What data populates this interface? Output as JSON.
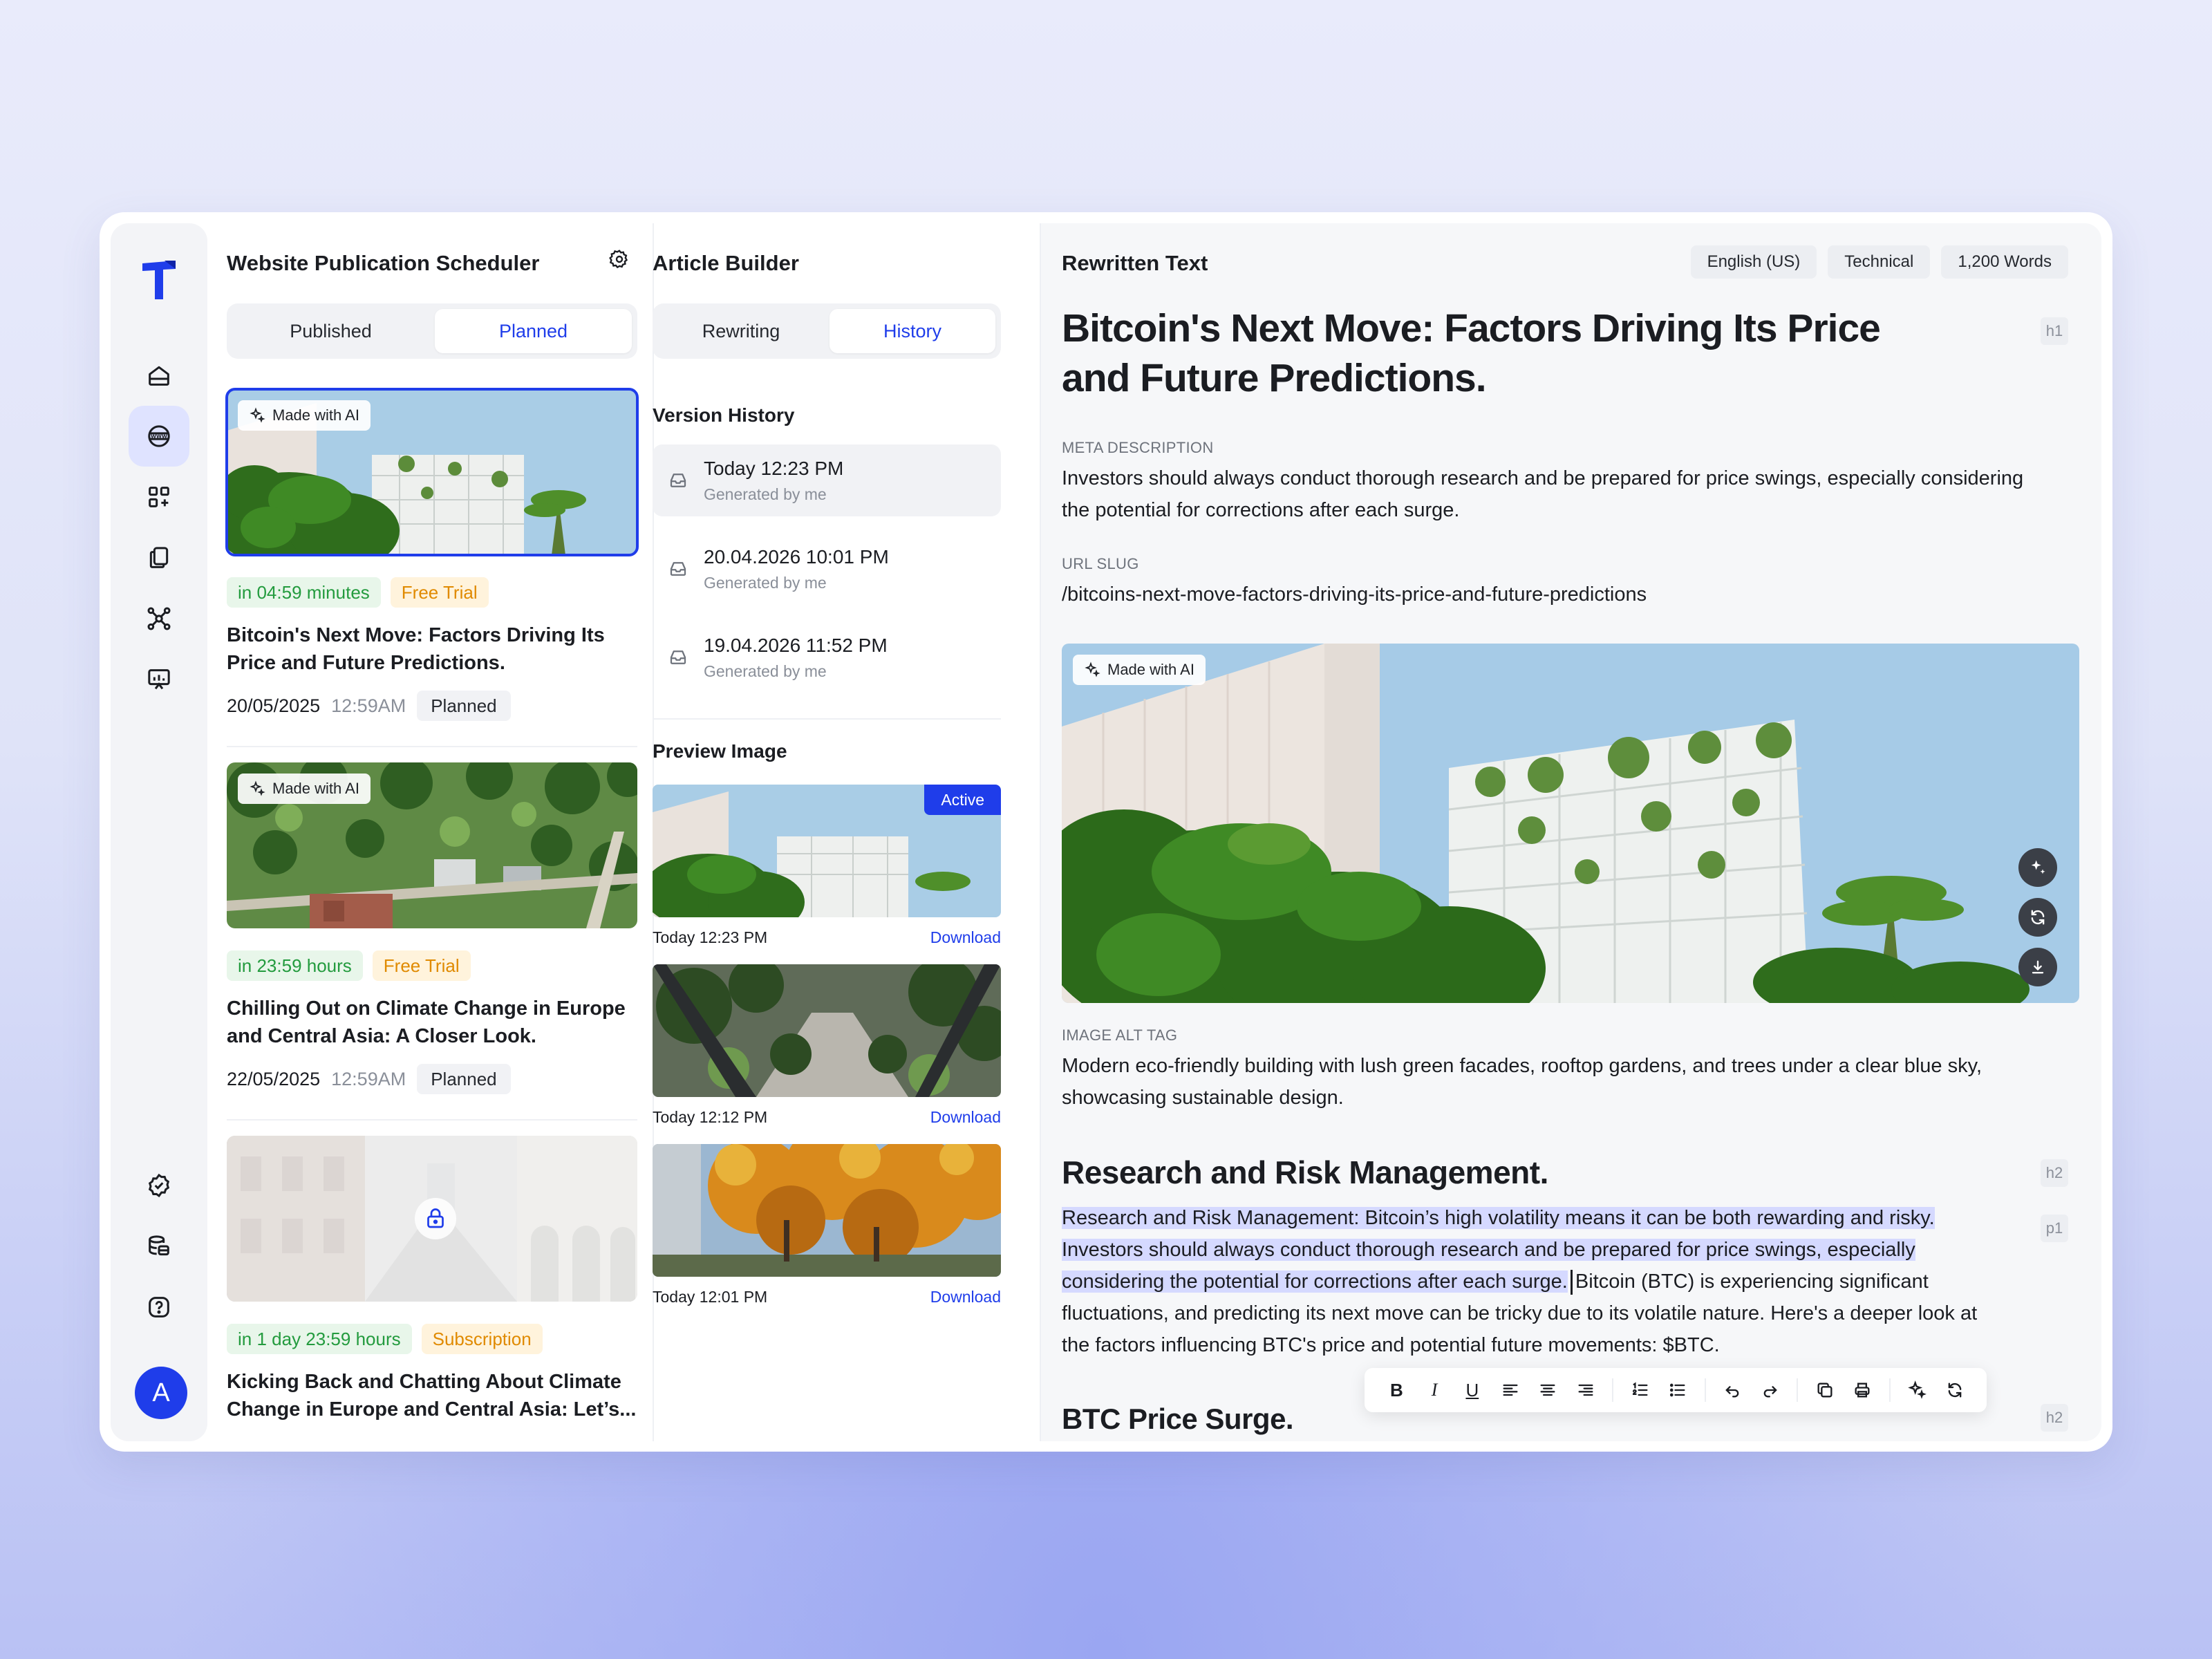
{
  "sidebar": {
    "avatar_initial": "A",
    "items": [
      "home-icon",
      "website-icon",
      "apps-icon",
      "documents-icon",
      "network-icon",
      "analytics-icon",
      "verified-icon",
      "database-icon",
      "help-icon"
    ]
  },
  "scheduler": {
    "title": "Website Publication Scheduler",
    "tabs": [
      "Published",
      "Planned"
    ],
    "active_tab": "Planned",
    "cards": [
      {
        "ai_label": "Made with AI",
        "eta": "in 04:59 minutes",
        "plan": "Free Trial",
        "title": "Bitcoin's Next Move: Factors Driving Its Price and Future Predictions.",
        "date": "20/05/2025",
        "time": "12:59AM",
        "status": "Planned"
      },
      {
        "ai_label": "Made with AI",
        "eta": "in 23:59 hours",
        "plan": "Free Trial",
        "title": "Chilling Out on Climate Change in Europe and Central Asia: A Closer Look.",
        "date": "22/05/2025",
        "time": "12:59AM",
        "status": "Planned"
      },
      {
        "eta": "in 1 day 23:59 hours",
        "plan": "Subscription",
        "title": "Kicking Back and Chatting About Climate Change in Europe and Central Asia: Let’s..."
      }
    ]
  },
  "builder": {
    "title": "Article Builder",
    "tabs": [
      "Rewriting",
      "History"
    ],
    "active_tab": "History",
    "version_title": "Version History",
    "versions": [
      {
        "time": "Today 12:23 PM",
        "by": "Generated by me"
      },
      {
        "time": "20.04.2026 10:01 PM",
        "by": "Generated by me"
      },
      {
        "time": "19.04.2026 11:52 PM",
        "by": "Generated by me"
      }
    ],
    "preview_title": "Preview Image",
    "active_label": "Active",
    "previews": [
      {
        "time": "Today 12:23 PM",
        "action": "Download"
      },
      {
        "time": "Today 12:12 PM",
        "action": "Download"
      },
      {
        "time": "Today 12:01 PM",
        "action": "Download"
      }
    ]
  },
  "editor": {
    "title": "Rewritten Text",
    "chips": [
      "English (US)",
      "Technical",
      "1,200 Words"
    ],
    "h1": "Bitcoin's Next Move: Factors Driving Its Price and Future Predictions.",
    "h1_tag": "h1",
    "meta_label": "META DESCRIPTION",
    "meta_text": "Investors should always conduct thorough research and be prepared for price swings, especially considering the potential for corrections after each surge.",
    "slug_label": "URL SLUG",
    "slug_text": "/bitcoins-next-move-factors-driving-its-price-and-future-predictions",
    "hero_ai_label": "Made with AI",
    "alt_label": "IMAGE ALT TAG",
    "alt_text": "Modern eco-friendly building with lush green facades, rooftop gardens, and trees under a clear blue sky, showcasing sustainable design.",
    "h2a": "Research and Risk Management.",
    "h2_tag": "h2",
    "p1_tag": "p1",
    "para_highlight": "Research and Risk Management: Bitcoin’s high volatility means it can be both rewarding and risky. Investors should always conduct thorough research and be prepared for price swings, especially considering the potential for corrections after each surge.",
    "para_rest": "Bitcoin (BTC) is experiencing significant fluctuations, and predicting its next move can be tricky due to its volatile nature. Here's a deeper look at the factors influencing BTC's price and potential future movements: $BTC.",
    "h2b": "BTC Price Surge.",
    "toolbar": {
      "bold": "B",
      "italic": "I",
      "underline": "U"
    }
  },
  "colors": {
    "accent": "#1f3dea",
    "green": "#239b3e",
    "orange": "#e08a00",
    "highlight": "#d5d9ff"
  }
}
